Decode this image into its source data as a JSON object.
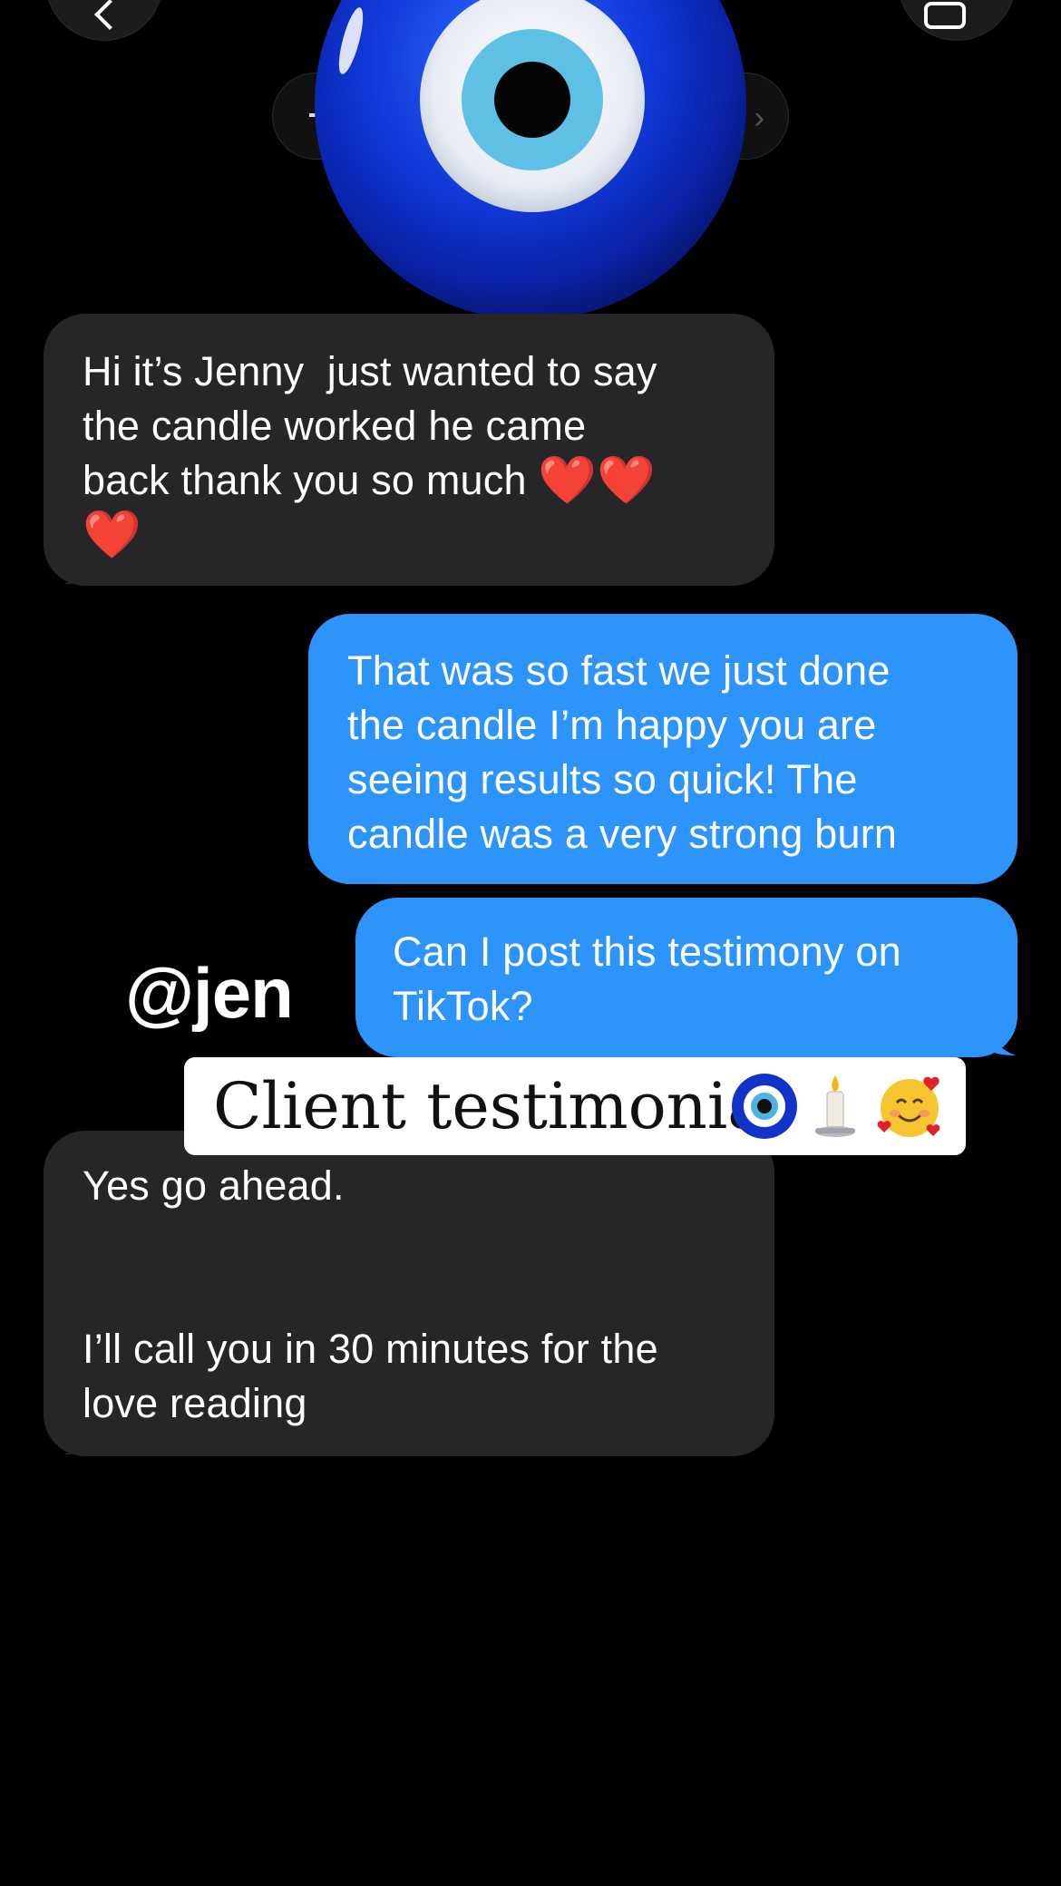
{
  "header": {
    "back_icon": "chevron-left-icon",
    "video_icon": "video-camera-icon",
    "avatar": "evil-eye-emoji"
  },
  "overlay": {
    "handle": "@jen",
    "caption": "Client testimonial",
    "caption_emojis": [
      "nazar-amulet",
      "candle",
      "smiling-face-with-hearts"
    ]
  },
  "messages": [
    {
      "direction": "received",
      "lines": [
        "Hi it’s Jenny  just wanted to say",
        "the candle worked he came",
        "back thank you so much"
      ],
      "emojis": [
        "❤️",
        "❤️",
        "❤️"
      ]
    },
    {
      "direction": "sent",
      "lines": [
        "That was so fast we just done",
        "the candle I’m happy you are",
        "seeing results so quick! The",
        "candle was a very strong burn"
      ]
    },
    {
      "direction": "sent",
      "lines": [
        "Can I post this testimony on",
        "TikTok?"
      ]
    },
    {
      "direction": "received",
      "lines": [
        "Yes go ahead.",
        "",
        "",
        "I’ll call you in 30 minutes for the",
        "love reading"
      ]
    }
  ],
  "colors": {
    "background": "#000000",
    "received_bubble": "#262629",
    "sent_bubble": "#2c94fa",
    "caption_bg": "#ffffff"
  }
}
